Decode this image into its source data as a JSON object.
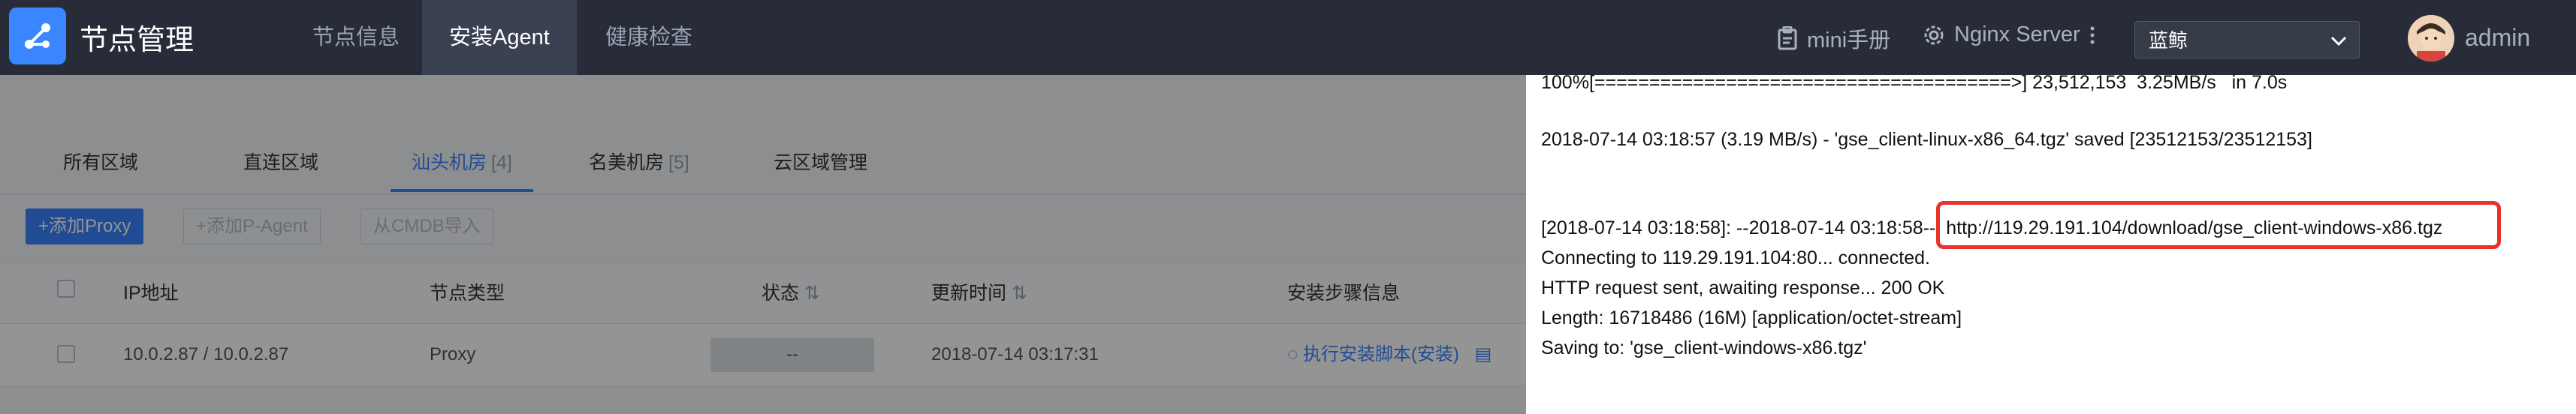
{
  "header": {
    "app_title": "节点管理",
    "nav_tabs": [
      {
        "label": "节点信息"
      },
      {
        "label": "安装Agent"
      },
      {
        "label": "健康检查"
      }
    ],
    "manual_label": "mini手册",
    "server_label": "Nginx Server",
    "region_select": "蓝鲸",
    "user_name": "admin"
  },
  "page": {
    "area_tabs": [
      {
        "label": "所有区域",
        "count": ""
      },
      {
        "label": "直连区域",
        "count": ""
      },
      {
        "label": "汕头机房",
        "count": "[4]"
      },
      {
        "label": "名美机房",
        "count": "[5]"
      },
      {
        "label": "云区域管理",
        "count": ""
      }
    ],
    "actions": {
      "add_proxy": "+添加Proxy",
      "add_pagent": "+添加P-Agent",
      "import_cmdb": "从CMDB导入"
    },
    "table": {
      "columns": [
        "IP地址",
        "节点类型",
        "状态",
        "更新时间",
        "安装步骤信息"
      ],
      "rows": [
        {
          "ip": "10.0.2.87 / 10.0.2.87",
          "type": "Proxy",
          "status": "--",
          "updated": "2018-07-14 03:17:31",
          "step": "执行安装脚本(安装)"
        }
      ]
    }
  },
  "log": {
    "lines": [
      "100%[======================================>] 23,512,153  3.25MB/s   in 7.0s",
      "2018-07-14 03:18:57 (3.19 MB/s) - 'gse_client-linux-x86_64.tgz' saved [23512153/23512153]",
      "[2018-07-14 03:18:58]: --2018-07-14 03:18:58--  http://119.29.191.104/download/gse_client-windows-x86.tgz",
      "Connecting to 119.29.191.104:80... connected.",
      "HTTP request sent, awaiting response... 200 OK",
      "Length: 16718486 (16M) [application/octet-stream]",
      "Saving to: 'gse_client-windows-x86.tgz'"
    ]
  },
  "colors": {
    "topbar": "#272c38",
    "accent": "#3a84ff",
    "highlight": "#e8322b"
  }
}
